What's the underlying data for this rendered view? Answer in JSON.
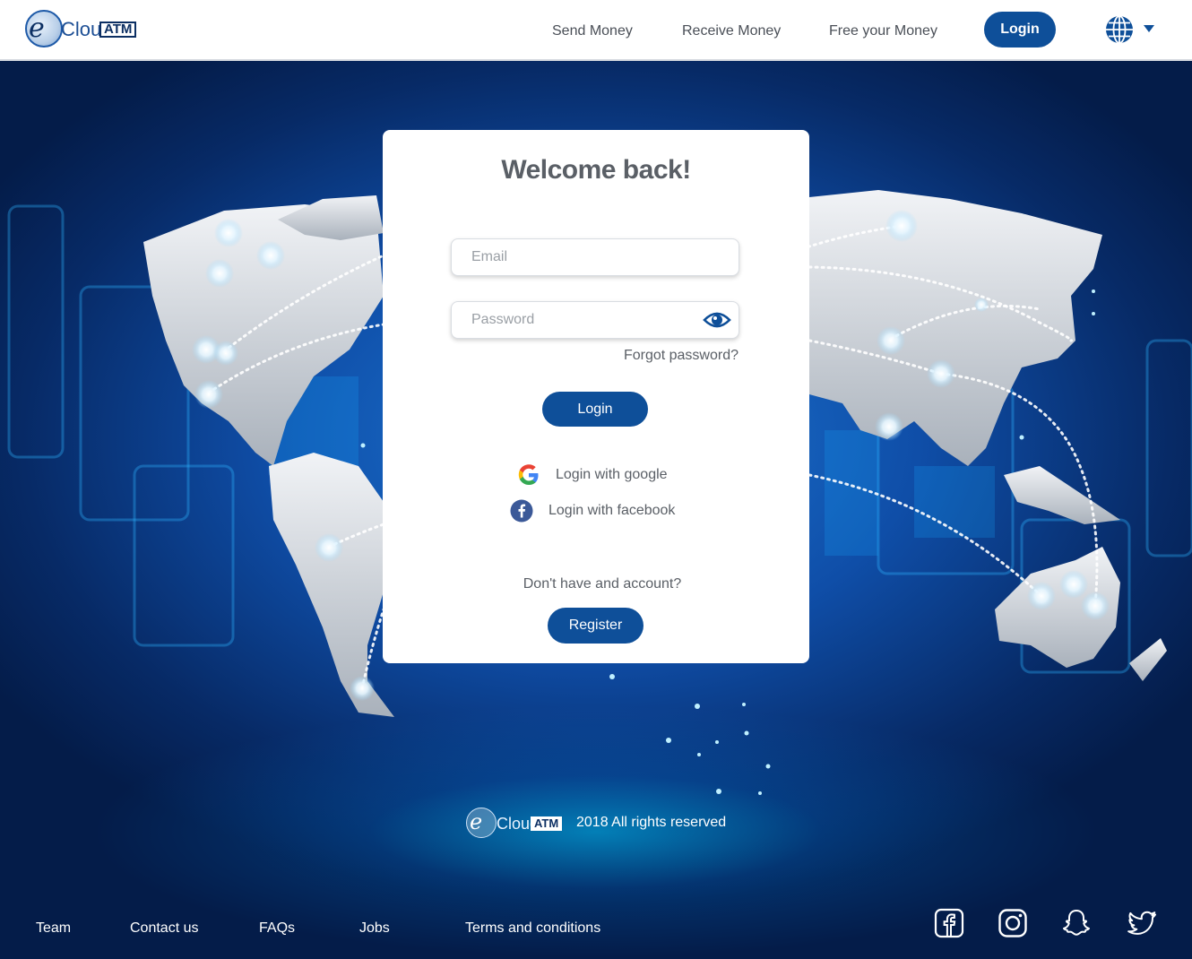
{
  "header": {
    "logo": {
      "prefix": "e",
      "cloud": "Cloud",
      "atm": "ATM"
    },
    "nav": [
      {
        "label": "Send Money"
      },
      {
        "label": "Receive Money"
      },
      {
        "label": "Free your Money"
      }
    ],
    "login_label": "Login",
    "language_icon": "globe-icon"
  },
  "login_card": {
    "title": "Welcome back!",
    "email_placeholder": "Email",
    "password_placeholder": "Password",
    "forgot_label": "Forgot password?",
    "login_label": "Login",
    "google_label": "Login with google",
    "facebook_label": "Login with facebook",
    "no_account_text": "Don't have and account?",
    "register_label": "Register"
  },
  "footer": {
    "copyright_text": "2018 All rights reserved",
    "links": [
      {
        "label": "Team"
      },
      {
        "label": "Contact us"
      },
      {
        "label": "FAQs"
      },
      {
        "label": "Jobs"
      },
      {
        "label": "Terms and conditions"
      }
    ],
    "social_icons": [
      "facebook-icon",
      "instagram-icon",
      "snapchat-icon",
      "twitter-icon"
    ]
  },
  "colors": {
    "primary": "#0e4f99",
    "background_deep": "#072a66",
    "glow": "#00c8ff",
    "text_gray": "#5a5f66"
  }
}
